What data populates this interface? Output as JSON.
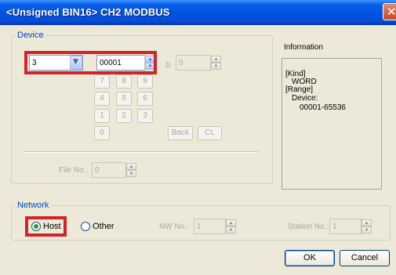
{
  "window": {
    "title": "<Unsigned BIN16> CH2 MODBUS",
    "close_glyph": "✕"
  },
  "device": {
    "legend": "Device",
    "type_value": "3",
    "address_value": "00001",
    "b_label": ".b",
    "b_value": "0",
    "keypad": [
      "7",
      "8",
      "9",
      "4",
      "5",
      "6",
      "1",
      "2",
      "3",
      "0"
    ],
    "back_label": "Back",
    "cl_label": "CL",
    "file_no_label": "File No.:",
    "file_no_value": "0"
  },
  "information": {
    "title": "Information",
    "kind_header": "[Kind]",
    "kind_value": "WORD",
    "range_header": "[Range]",
    "range_label": "Device:",
    "range_value": "00001-65536"
  },
  "network": {
    "legend": "Network",
    "host_label": "Host",
    "other_label": "Other",
    "host_selected": true,
    "nw_no_label": "NW No.:",
    "nw_no_value": "1",
    "station_no_label": "Station No.:",
    "station_no_value": "1"
  },
  "buttons": {
    "ok": "OK",
    "cancel": "Cancel"
  },
  "colors": {
    "highlight": "#d2232a",
    "titlebar": "#0054e3",
    "accent_text": "#0046d5"
  },
  "icons": [
    "dropdown-arrow-icon",
    "spin-up-icon",
    "spin-down-icon",
    "close-icon"
  ]
}
